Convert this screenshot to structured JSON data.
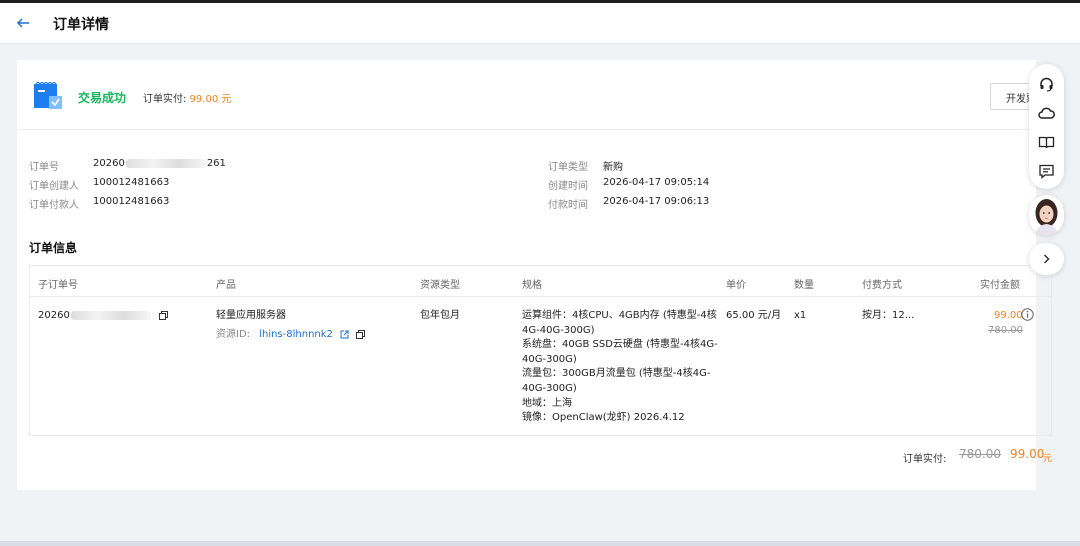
{
  "header": {
    "title": "订单详情"
  },
  "status": {
    "text": "交易成功",
    "paid_label": "订单实付:",
    "paid_value": "99.00 元",
    "invoice_button": "开发票"
  },
  "info": {
    "order_no_label": "订单号",
    "order_no_prefix": "20260",
    "order_no_suffix": "261",
    "creator_label": "订单创建人",
    "creator_value": "100012481663",
    "payer_label": "订单付款人",
    "payer_value": "100012481663",
    "type_label": "订单类型",
    "type_value": "新购",
    "created_label": "创建时间",
    "created_value": "2026-04-17 09:05:14",
    "paid_time_label": "付款时间",
    "paid_time_value": "2026-04-17 09:06:13"
  },
  "order_info": {
    "title": "订单信息",
    "columns": [
      "子订单号",
      "产品",
      "资源类型",
      "规格",
      "单价",
      "数量",
      "付费方式",
      "实付金额"
    ],
    "row": {
      "sub_order_prefix": "20260",
      "product": "轻量应用服务器",
      "resource_label": "资源ID:",
      "resource_id": "lhins-8lhnnnk2",
      "resource_type": "包年包月",
      "spec": [
        "运算组件：4核CPU、4GB内存 (特惠型-4核",
        "4G-40G-300G)",
        "系统盘：40GB SSD云硬盘 (特惠型-4核4G-",
        "40G-300G)",
        "流量包：300GB月流量包 (特惠型-4核4G-",
        "40G-300G)",
        "地域：上海",
        "镜像：OpenClaw(龙虾) 2026.4.12"
      ],
      "unit_price": "65.00 元/月",
      "quantity": "x1",
      "billing": "按月：12...",
      "paid": "99.00",
      "original": "780.00"
    }
  },
  "total": {
    "label": "订单实付:",
    "original": "780.00",
    "paid": "99.00",
    "unit": "元"
  },
  "colors": {
    "success": "#14b85a",
    "accent": "#f0831e",
    "link": "#1a6fd4"
  },
  "icons": [
    "back-arrow-icon",
    "document-check-icon",
    "headset-icon",
    "cloud-icon",
    "book-icon",
    "feedback-icon",
    "chevron-right-icon",
    "copy-icon",
    "external-link-icon",
    "info-icon"
  ]
}
